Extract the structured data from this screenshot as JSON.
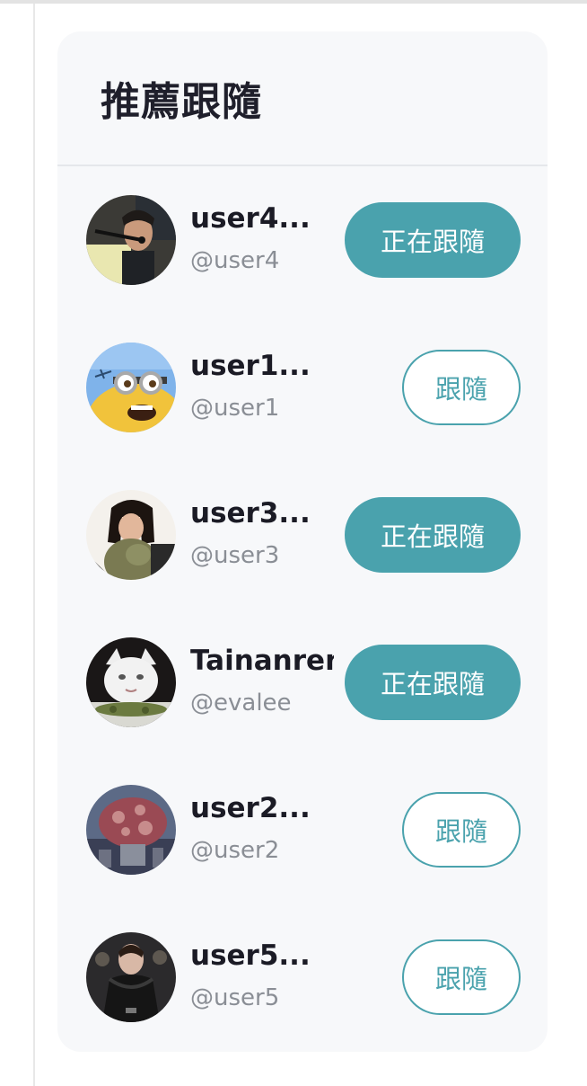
{
  "panel": {
    "title": "推薦跟隨"
  },
  "users": [
    {
      "name": "user4...",
      "handle": "@user4",
      "button": "正在跟隨",
      "following": true,
      "avatar_icon": "singer-photo"
    },
    {
      "name": "user1...",
      "handle": "@user1",
      "button": "跟隨",
      "following": false,
      "avatar_icon": "minion-photo"
    },
    {
      "name": "user3...",
      "handle": "@user3",
      "button": "正在跟隨",
      "following": true,
      "avatar_icon": "girl-with-plant-photo"
    },
    {
      "name": "Tainanren",
      "handle": "@evalee",
      "button": "正在跟隨",
      "following": true,
      "avatar_icon": "white-cat-photo"
    },
    {
      "name": "user2...",
      "handle": "@user2",
      "button": "跟隨",
      "following": false,
      "avatar_icon": "mushroom-planet-photo"
    },
    {
      "name": "user5...",
      "handle": "@user5",
      "button": "跟隨",
      "following": false,
      "avatar_icon": "dark-costume-photo"
    }
  ],
  "colors": {
    "accent": "#4aa2ad",
    "panel_bg": "#f7f8fa"
  }
}
